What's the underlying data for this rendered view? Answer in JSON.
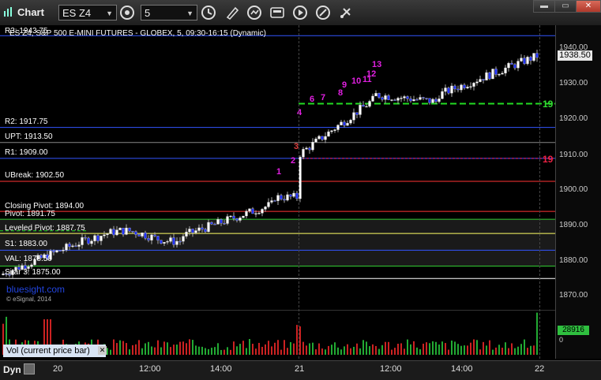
{
  "toolbar": {
    "title": "Chart",
    "symbol": "ES Z4",
    "interval": "5",
    "buttons": [
      "lock-icon",
      "clock-icon",
      "pencil-icon",
      "refresh-icon",
      "quote-icon",
      "play-icon",
      "draw-icon",
      "settings-icon"
    ]
  },
  "chart": {
    "title": "ES Z4, S&P 500 E-MINI FUTURES - GLOBEX, 5, 09:30-16:15 (Dynamic)",
    "price_axis": [
      "1940.00",
      "1930.00",
      "1920.00",
      "1910.00",
      "1900.00",
      "1890.00",
      "1880.00",
      "1870.00"
    ],
    "last_price": "1938.50",
    "levels": [
      {
        "label": "R3: 1943.75",
        "color": "#3355ff"
      },
      {
        "label": "R2: 1917.75",
        "color": "#3355ff"
      },
      {
        "label": "UPT: 1913.50",
        "color": "#aaaaaa"
      },
      {
        "label": "R1: 1909.00",
        "color": "#3355ff"
      },
      {
        "label": "UBreak: 1902.50",
        "color": "#ff3333"
      },
      {
        "label": "Closing Pivot: 1894.00",
        "color": "#ff3333"
      },
      {
        "label": "Pivot: 1891.75",
        "color": "#33cc33"
      },
      {
        "label": "Leveled Pivot: 1887.75",
        "color": "#ffff66"
      },
      {
        "label": "S1: 1883.00",
        "color": "#3355ff"
      },
      {
        "label": "VAL: 1878.50",
        "color": "#33cc33"
      },
      {
        "label": "Sitar 3: 1875.00",
        "color": "#ffffff"
      }
    ],
    "sequence_labels": [
      "1",
      "2",
      "3",
      "4",
      "6",
      "7",
      "8",
      "9",
      "10",
      "11",
      "12",
      "13"
    ],
    "right_marks": [
      "19",
      "19"
    ],
    "watermark": "bluesight.com",
    "copyright": "© eSignal, 2014"
  },
  "volume": {
    "label": "Vol (current price bar)",
    "last": "28916",
    "zero": "0"
  },
  "time_axis": {
    "mode": "Dyn",
    "labels": [
      "20",
      "12:00",
      "14:00",
      "21",
      "12:00",
      "14:00",
      "22"
    ]
  }
}
